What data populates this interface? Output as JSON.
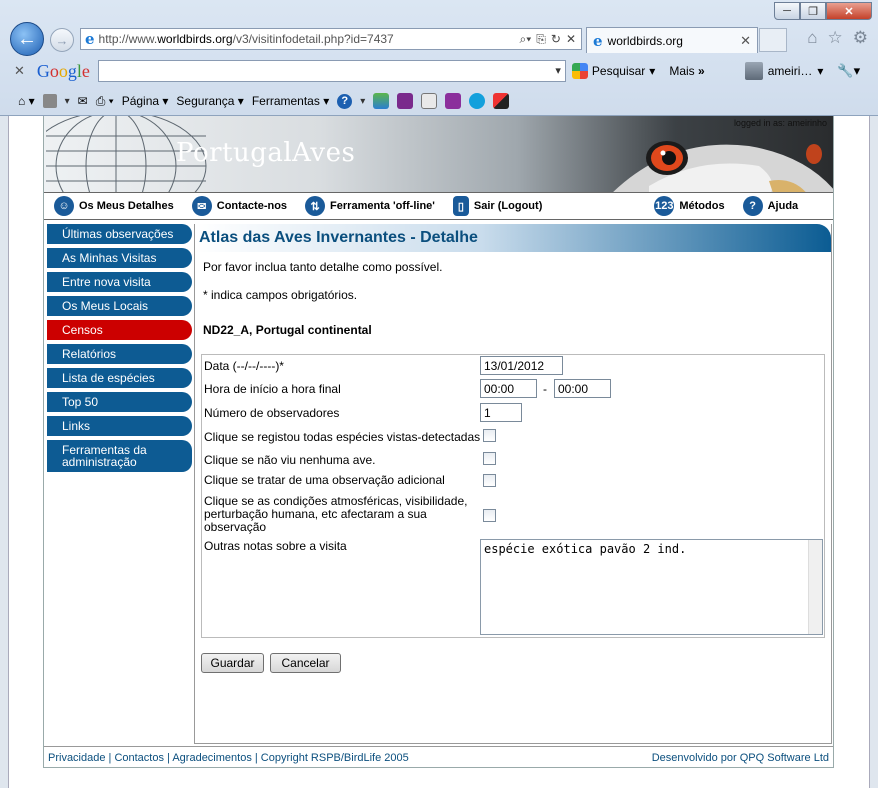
{
  "browser": {
    "url": "http://www.worldbirds.org/v3/visitinfodetail.php?id=7437",
    "url_domain": "worldbirds.org",
    "url_prefix": "http://www.",
    "url_suffix": "/v3/visitinfodetail.php?id=7437",
    "tab_title": "worldbirds.org",
    "window_controls": {
      "minimize": "─",
      "restore": "❐",
      "close": "✕"
    }
  },
  "google_toolbar": {
    "logo": "Google",
    "search_button": "Pesquisar",
    "more": "Mais",
    "more_arrows": "»",
    "user": "ameiri…"
  },
  "command_bar": {
    "page": "Página",
    "security": "Segurança",
    "tools": "Ferramentas"
  },
  "site": {
    "logo": "PortugalAves",
    "logged_in": "logged in as: ameirinho",
    "nav": [
      "Os Meus Detalhes",
      "Contacte-nos",
      "Ferramenta 'off-line'",
      "Sair (Logout)",
      "Métodos",
      "Ajuda"
    ],
    "sidebar": [
      "Últimas observações",
      "As Minhas Visitas",
      "Entre nova visita",
      "Os Meus Locais",
      "Censos",
      "Relatórios",
      "Lista de espécies",
      "Top 50",
      "Links",
      "Ferramentas da administração"
    ],
    "active_sidebar": "Censos",
    "footer_links": "Privacidade | Contactos | Agradecimentos | Copyright RSPB/BirdLife 2005",
    "footer_credit": "Desenvolvido por QPQ Software Ltd"
  },
  "main": {
    "title": "Atlas das Aves Invernantes - Detalhe",
    "intro": "Por favor inclua tanto detalhe como possível.",
    "required_note": "* indica campos obrigatórios.",
    "location": "ND22_A, Portugal continental",
    "form": {
      "date_label": "Data (--/--/----)*",
      "date_value": "13/01/2012",
      "time_label": "Hora de início a hora final",
      "time_start": "00:00",
      "time_sep": "-",
      "time_end": "00:00",
      "observers_label": "Número de observadores",
      "observers_value": "1",
      "all_species_label": "Clique se registou todas espécies vistas-detectadas",
      "none_seen_label": "Clique se não viu nenhuma ave.",
      "additional_label": "Clique se tratar de uma observação adicional",
      "conditions_label": "Clique se as condições atmosféricas, visibilidade, perturbação humana, etc afectaram a sua observação",
      "notes_label": "Outras notas sobre a visita",
      "notes_value": "espécie exótica pavão 2 ind."
    },
    "save_button": "Guardar",
    "cancel_button": "Cancelar"
  },
  "colors": {
    "nav_blue": "#0d5b93",
    "active_red": "#cc0000",
    "header_text": "#0b4f7e"
  }
}
